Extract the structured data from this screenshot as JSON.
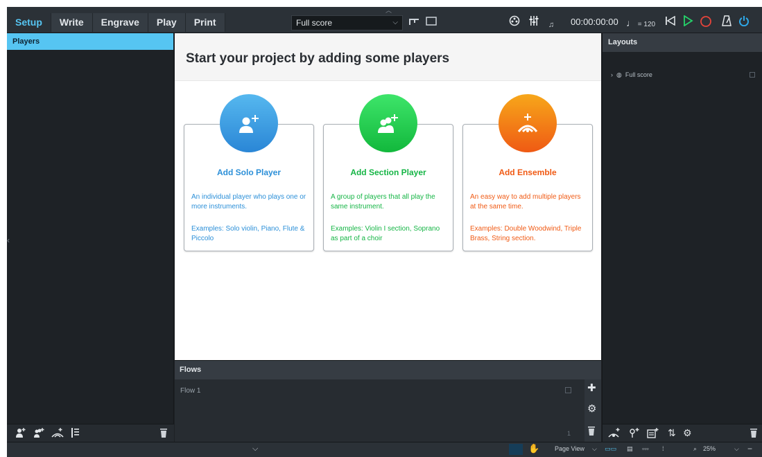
{
  "toolbar": {
    "tabs": [
      {
        "label": "Setup",
        "active": true
      },
      {
        "label": "Write",
        "active": false
      },
      {
        "label": "Engrave",
        "active": false
      },
      {
        "label": "Play",
        "active": false
      },
      {
        "label": "Print",
        "active": false
      }
    ],
    "layout_select": "Full score",
    "time": "00:00:00:00",
    "tempo": "= 120"
  },
  "players": {
    "title": "Players"
  },
  "main": {
    "heading": "Start your project by adding some players",
    "cards": [
      {
        "title": "Add Solo Player",
        "desc": "An individual player who plays one or more instruments.",
        "examples": "Examples: Solo violin, Piano, Flute & Piccolo",
        "color": "#2b8fd8",
        "gradient_top": "#56b8ef",
        "gradient_bottom": "#2a86d6"
      },
      {
        "title": "Add Section Player",
        "desc": "A group of players that all play the same instrument.",
        "examples": "Examples: Violin I section, Soprano as part of a choir",
        "color": "#15b545",
        "gradient_top": "#3ee56a",
        "gradient_bottom": "#12b83c"
      },
      {
        "title": "Add Ensemble",
        "desc": "An easy way to add multiple players at the same time.",
        "examples": "Examples: Double Woodwind, Triple Brass, String section.",
        "color": "#f05a14",
        "gradient_top": "#f7a71a",
        "gradient_bottom": "#ef5a14"
      }
    ]
  },
  "flows": {
    "title": "Flows",
    "items": [
      "Flow 1"
    ],
    "count": "1"
  },
  "layouts": {
    "title": "Layouts",
    "items": [
      "Full score"
    ]
  },
  "status": {
    "view": "Page View",
    "zoom": "25%"
  },
  "colors": {
    "accent": "#56c5f2",
    "panel": "#1e2226",
    "toolbar": "#2b3137"
  }
}
